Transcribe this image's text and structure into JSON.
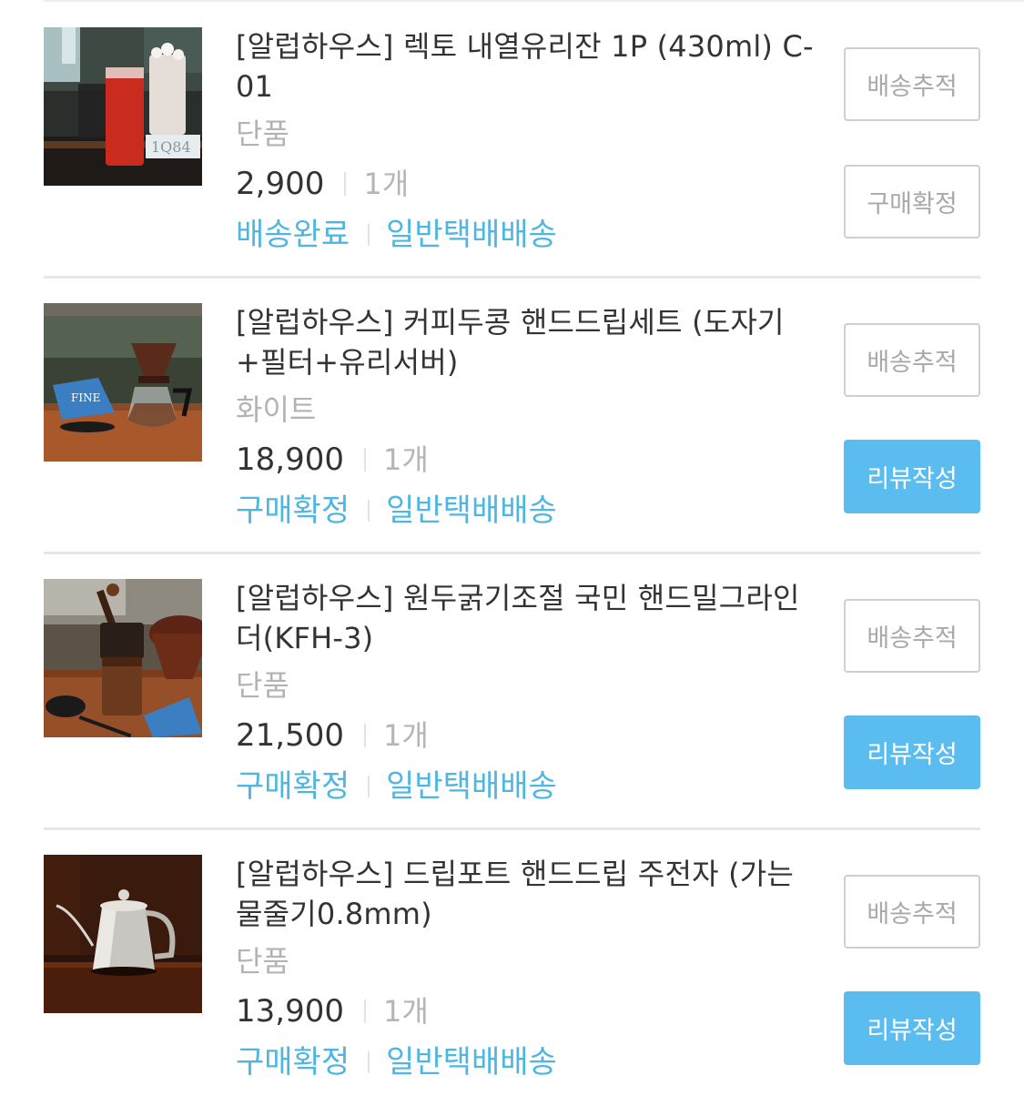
{
  "order_items": [
    {
      "title": "[알럽하우스] 렉토 내열유리잔 1P (430ml) C-01",
      "option": "단품",
      "price": "2,900",
      "quantity": "1개",
      "status": "배송완료",
      "shipping_method": "일반택배배송",
      "image": "glass-cups-photo",
      "buttons": {
        "top": "배송추적",
        "bottom": "구매확정"
      }
    },
    {
      "title": "[알럽하우스] 커피두콩 핸드드립세트 (도자기+필터+유리서버)",
      "option": "화이트",
      "price": "18,900",
      "quantity": "1개",
      "status": "구매확정",
      "shipping_method": "일반택배배송",
      "image": "hand-drip-set-photo",
      "buttons": {
        "top": "배송추적",
        "bottom": "리뷰작성"
      }
    },
    {
      "title": "[알럽하우스] 원두굵기조절 국민 핸드밀그라인더(KFH-3)",
      "option": "단품",
      "price": "21,500",
      "quantity": "1개",
      "status": "구매확정",
      "shipping_method": "일반택배배송",
      "image": "hand-mill-grinder-photo",
      "buttons": {
        "top": "배송추적",
        "bottom": "리뷰작성"
      }
    },
    {
      "title": "[알럽하우스] 드립포트 핸드드립 주전자 (가는물줄기0.8mm)",
      "option": "단품",
      "price": "13,900",
      "quantity": "1개",
      "status": "구매확정",
      "shipping_method": "일반택배배송",
      "image": "drip-kettle-photo",
      "buttons": {
        "top": "배송추적",
        "bottom": "리뷰작성"
      }
    }
  ],
  "colors": {
    "accent": "#5bbdef",
    "status_text": "#4fb6e2",
    "muted_text": "#b3b3b3",
    "primary_text": "#333333",
    "divider": "#e6e6e6"
  }
}
